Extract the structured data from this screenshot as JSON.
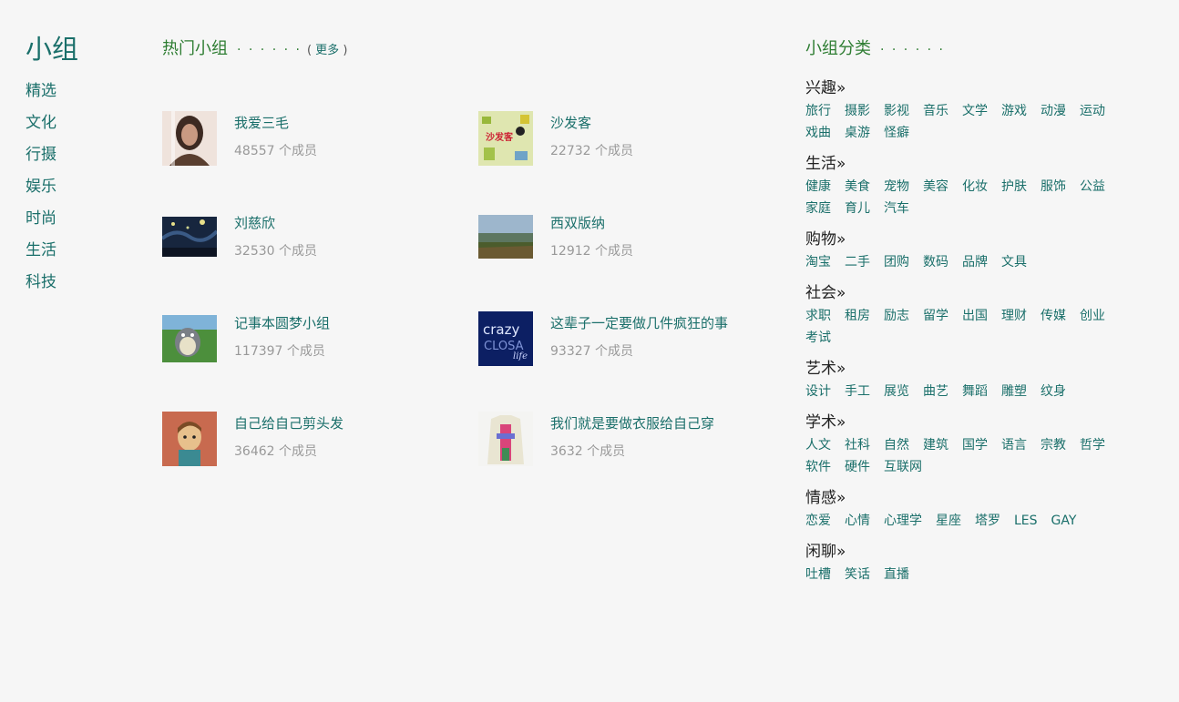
{
  "left_nav": {
    "title": "小组",
    "items": [
      "精选",
      "文化",
      "行摄",
      "娱乐",
      "时尚",
      "生活",
      "科技"
    ]
  },
  "hot": {
    "title": "热门小组",
    "dots": "· · · · · ·",
    "more_open": "( ",
    "more": "更多",
    "more_close": " )",
    "groups": [
      {
        "name": "我爱三毛",
        "members": "48557 个成员",
        "thumb": "portrait-woman"
      },
      {
        "name": "沙发客",
        "members": "22732 个成员",
        "thumb": "sofa-poster"
      },
      {
        "name": "刘慈欣",
        "members": "32530 个成员",
        "thumb": "night-sky"
      },
      {
        "name": "西双版纳",
        "members": "12912 个成员",
        "thumb": "landscape"
      },
      {
        "name": "记事本圆梦小组",
        "members": "117397 个成员",
        "thumb": "totoro"
      },
      {
        "name": "这辈子一定要做几件疯狂的事",
        "members": "93327 个成员",
        "thumb": "crazy-life"
      },
      {
        "name": "自己给自己剪头发",
        "members": "36462 个成员",
        "thumb": "haircut-cartoon"
      },
      {
        "name": "我们就是要做衣服给自己穿",
        "members": "3632 个成员",
        "thumb": "clothes"
      }
    ]
  },
  "categories": {
    "title": "小组分类",
    "dots": "· · · · · ·",
    "blocks": [
      {
        "name": "兴趣»",
        "tags": [
          "旅行",
          "摄影",
          "影视",
          "音乐",
          "文学",
          "游戏",
          "动漫",
          "运动",
          "戏曲",
          "桌游",
          "怪癖"
        ]
      },
      {
        "name": "生活»",
        "tags": [
          "健康",
          "美食",
          "宠物",
          "美容",
          "化妆",
          "护肤",
          "服饰",
          "公益",
          "家庭",
          "育儿",
          "汽车"
        ]
      },
      {
        "name": "购物»",
        "tags": [
          "淘宝",
          "二手",
          "团购",
          "数码",
          "品牌",
          "文具"
        ]
      },
      {
        "name": "社会»",
        "tags": [
          "求职",
          "租房",
          "励志",
          "留学",
          "出国",
          "理财",
          "传媒",
          "创业",
          "考试"
        ]
      },
      {
        "name": "艺术»",
        "tags": [
          "设计",
          "手工",
          "展览",
          "曲艺",
          "舞蹈",
          "雕塑",
          "纹身"
        ]
      },
      {
        "name": "学术»",
        "tags": [
          "人文",
          "社科",
          "自然",
          "建筑",
          "国学",
          "语言",
          "宗教",
          "哲学",
          "软件",
          "硬件",
          "互联网"
        ]
      },
      {
        "name": "情感»",
        "tags": [
          "恋爱",
          "心情",
          "心理学",
          "星座",
          "塔罗",
          "LES",
          "GAY"
        ]
      },
      {
        "name": "闲聊»",
        "tags": [
          "吐槽",
          "笑话",
          "直播"
        ]
      }
    ]
  }
}
